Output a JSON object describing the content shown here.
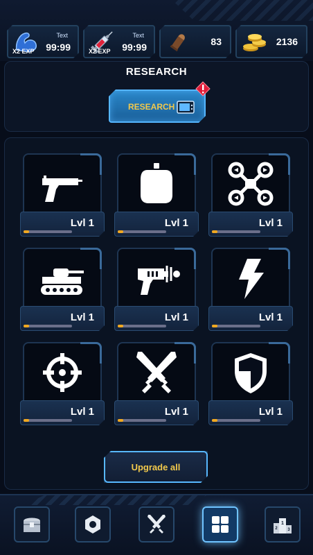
{
  "top_bar": {
    "boosts": [
      {
        "icon": "muscle-arm-icon",
        "exp_label": "X2 EXP",
        "small_text": "Text",
        "timer": "99:99"
      },
      {
        "icon": "syringe-icon",
        "exp_label": "X2 EXP",
        "small_text": "Text",
        "timer": "99:99"
      }
    ],
    "bullets": {
      "icon": "bullet-icon",
      "value": "83"
    },
    "coins": {
      "icon": "gold-coins-icon",
      "value": "2136"
    }
  },
  "research": {
    "title": "RESEARCH",
    "button_label": "RESEARCH",
    "button_icon": "tv-icon",
    "alert_icon": "alert-badge-icon"
  },
  "upgrades": [
    {
      "icon": "pistol-icon",
      "level_label": "Lvl 1",
      "progress": 0.12
    },
    {
      "icon": "grenade-icon",
      "level_label": "Lvl 1",
      "progress": 0.12
    },
    {
      "icon": "drone-icon",
      "level_label": "Lvl 1",
      "progress": 0.12
    },
    {
      "icon": "tank-icon",
      "level_label": "Lvl 1",
      "progress": 0.12
    },
    {
      "icon": "ray-gun-icon",
      "level_label": "Lvl 1",
      "progress": 0.12
    },
    {
      "icon": "lightning-icon",
      "level_label": "Lvl 1",
      "progress": 0.12
    },
    {
      "icon": "crosshair-icon",
      "level_label": "Lvl 1",
      "progress": 0.12
    },
    {
      "icon": "crossed-swords-icon",
      "level_label": "Lvl 1",
      "progress": 0.12
    },
    {
      "icon": "shield-icon",
      "level_label": "Lvl 1",
      "progress": 0.12
    }
  ],
  "upgrade_all_label": "Upgrade all",
  "bottom_nav": [
    {
      "icon": "treasure-chest-icon",
      "active": false
    },
    {
      "icon": "hex-nut-icon",
      "active": false
    },
    {
      "icon": "crossed-swords-icon",
      "active": false
    },
    {
      "icon": "grid-icon",
      "active": true
    },
    {
      "icon": "podium-icon",
      "active": false
    }
  ],
  "colors": {
    "accent_blue": "#58b8ff",
    "gold_text": "#f2c94c",
    "progress_fill": "#f0a820",
    "background": "#070d1a"
  }
}
